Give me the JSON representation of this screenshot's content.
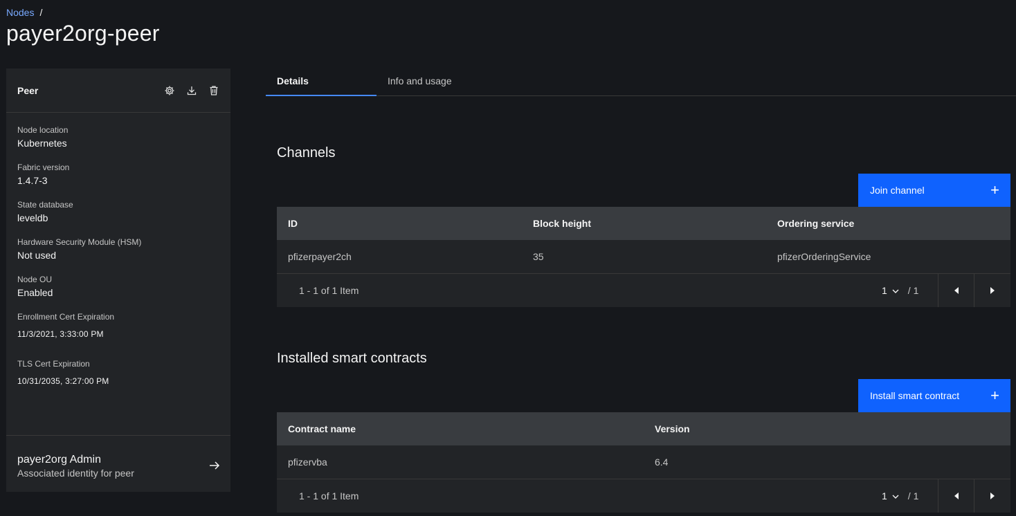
{
  "breadcrumb": {
    "link": "Nodes",
    "separator": "/"
  },
  "page_title": "payer2org-peer",
  "side_panel": {
    "title": "Peer",
    "icons": [
      "settings-icon",
      "download-icon",
      "trash-icon"
    ],
    "fields": [
      {
        "label": "Node location",
        "value": "Kubernetes"
      },
      {
        "label": "Fabric version",
        "value": "1.4.7-3"
      },
      {
        "label": "State database",
        "value": "leveldb"
      },
      {
        "label": "Hardware Security Module (HSM)",
        "value": "Not used"
      },
      {
        "label": "Node OU",
        "value": "Enabled"
      },
      {
        "label": "Enrollment Cert Expiration",
        "value": "11/3/2021, 3:33:00 PM"
      },
      {
        "label": "TLS Cert Expiration",
        "value": "10/31/2035, 3:27:00 PM"
      }
    ],
    "identity": {
      "name": "payer2org Admin",
      "subtitle": "Associated identity for peer"
    }
  },
  "tabs": [
    {
      "label": "Details",
      "active": true
    },
    {
      "label": "Info and usage",
      "active": false
    }
  ],
  "channels": {
    "title": "Channels",
    "button_label": "Join channel",
    "columns": [
      "ID",
      "Block height",
      "Ordering service"
    ],
    "rows": [
      [
        "pfizerpayer2ch",
        "35",
        "pfizerOrderingService"
      ]
    ],
    "pagination": {
      "count_text": "1 - 1 of 1 Item",
      "page": "1",
      "total": "/ 1"
    }
  },
  "contracts": {
    "title": "Installed smart contracts",
    "button_label": "Install smart contract",
    "columns": [
      "Contract name",
      "Version"
    ],
    "rows": [
      [
        "pfizervba",
        "6.4"
      ]
    ],
    "pagination": {
      "count_text": "1 - 1 of 1 Item",
      "page": "1",
      "total": "/ 1"
    }
  },
  "colors": {
    "accent": "#0f62fe",
    "link": "#78a9ff",
    "background": "#16181c",
    "panel": "#222427"
  }
}
